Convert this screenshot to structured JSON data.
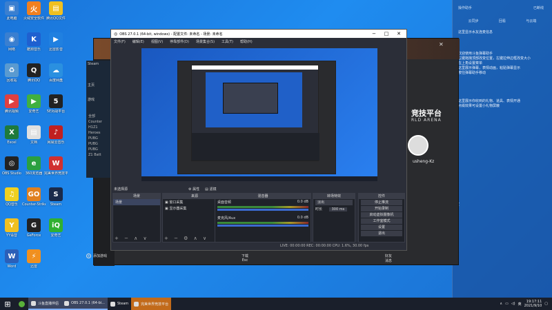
{
  "desktop_icons": [
    {
      "label": "此电脑",
      "color": "#3a7fd0",
      "glyph": "▣"
    },
    {
      "label": "火绒安全软件",
      "color": "#f08020",
      "glyph": "火"
    },
    {
      "label": "腾讯QQ文件",
      "color": "#f0c020",
      "glyph": "▤"
    },
    {
      "label": "网络",
      "color": "#3a7fd0",
      "glyph": "◉"
    },
    {
      "label": "酷狗音乐",
      "color": "#1f60d0",
      "glyph": "K"
    },
    {
      "label": "迅雷影音",
      "color": "#2080e0",
      "glyph": "▶"
    },
    {
      "label": "回收站",
      "color": "#5a9ad0",
      "glyph": "♻"
    },
    {
      "label": "腾讯QQ",
      "color": "#222222",
      "glyph": "Q"
    },
    {
      "label": "百度网盘",
      "color": "#2a90e0",
      "glyph": "☁"
    },
    {
      "label": "腾讯视频",
      "color": "#e04040",
      "glyph": "▶"
    },
    {
      "label": "爱奇艺",
      "color": "#40b040",
      "glyph": "▶"
    },
    {
      "label": "5E对战平台",
      "color": "#222222",
      "glyph": "5"
    },
    {
      "label": "Excel",
      "color": "#1e7a3c",
      "glyph": "X"
    },
    {
      "label": "文档",
      "color": "#e0e0e0",
      "glyph": "▤"
    },
    {
      "label": "网易云音乐",
      "color": "#c02020",
      "glyph": "♪"
    },
    {
      "label": "OBS Studio",
      "color": "#222222",
      "glyph": "◎"
    },
    {
      "label": "360浏览器",
      "color": "#2aa040",
      "glyph": "e"
    },
    {
      "label": "完美世界竞技平台",
      "color": "#d03030",
      "glyph": "W"
    },
    {
      "label": "QQ音乐",
      "color": "#f0d020",
      "glyph": "♫"
    },
    {
      "label": "Counter-Strike",
      "color": "#e08020",
      "glyph": "GO"
    },
    {
      "label": "Steam",
      "color": "#1a2a4a",
      "glyph": "S"
    },
    {
      "label": "YY语音",
      "color": "#f0c020",
      "glyph": "Y"
    },
    {
      "label": "GeForce",
      "color": "#222222",
      "glyph": "G"
    },
    {
      "label": "爱奇艺",
      "color": "#30b030",
      "glyph": "iQ"
    },
    {
      "label": "Word",
      "color": "#2b5fb8",
      "glyph": "W"
    },
    {
      "label": "迅雷",
      "color": "#f09020",
      "glyph": "⚡"
    }
  ],
  "notification_panel": {
    "title": "操作助手",
    "status": "已断线",
    "btn1": "云同步",
    "btn2": "回看",
    "btn3": "与云端",
    "note1": "这里显示水友连麦信息",
    "note2": "欢迎使用斗鱼弹幕助手",
    "note3": "左键拖拽顶部改变位置，左键拉伸边框改变大小",
    "note4": "在上角设置菜单",
    "note5": "这里展示弹幕，表情动画，粘贴弹幕显示",
    "note6": "按住弹幕助手移动",
    "note7": "这里展示你收到的礼物、道具、表情开通",
    "note8": "点缀效果可设置小礼物屏蔽",
    "btn_a": "设置",
    "btn_b": "清屏",
    "btn_c": "锁定"
  },
  "arena": {
    "title": "竞技平台",
    "subtitle": "RLD ARENA",
    "username": "usheng-Kz",
    "bottom_left": "添加游戏",
    "bottom_mid": "下载",
    "bottom_mid2": "Esc",
    "bottom_right": "好友",
    "bottom_right2": "消息",
    "sidebar_items": [
      "Steam",
      "主页",
      "游戏",
      "全部"
    ],
    "list_items": [
      "全部",
      "Counter",
      "H1Z1",
      "Heroes",
      "PUBG",
      "PUBG",
      "PUBG",
      "Z1 Batt"
    ]
  },
  "obs": {
    "title": "OBS 27.0.1 (64-bit, windows) - 配置文件: 未命名 - 场景: 未命名",
    "menu": [
      "文件(F)",
      "编辑(E)",
      "视图(V)",
      "停靠部件(D)",
      "场景集合(S)",
      "工具(T)",
      "帮助(H)"
    ],
    "no_source": "未选择源",
    "props_btn": "属性",
    "filters_btn": "滤镜",
    "scenes_title": "场景",
    "sources_title": "来源",
    "mixer_title": "混音器",
    "transitions_title": "转场特效",
    "controls_title": "控件",
    "scene_items": [
      "场景"
    ],
    "source_items": [
      "窗口采集",
      "显示器采集"
    ],
    "mixer_items": [
      {
        "name": "桌面音频",
        "level": "0.0 dB"
      },
      {
        "name": "麦克风/Aux",
        "level": "0.0 dB"
      }
    ],
    "transition_value": "淡出",
    "duration_label": "时长",
    "duration_value": "300 ms",
    "controls": [
      "停止推流",
      "开始录制",
      "启动虚拟摄像机",
      "工作室模式",
      "设置",
      "退出"
    ],
    "status": "LIVE: 00:00:00   REC: 00:00:00   CPU: 1.6%, 30.00 fps"
  },
  "taskbar": {
    "start": "⊞",
    "items": [
      {
        "label": "斗鱼直播伴侣",
        "style": "active"
      },
      {
        "label": "OBS 27.0.1 (64-bi...",
        "style": "active"
      },
      {
        "label": "Steam",
        "style": "normal"
      },
      {
        "label": "完美世界竞技平台",
        "style": "orange"
      }
    ],
    "time": "19:17:11",
    "date": "2021/9/10",
    "lang": "英"
  }
}
